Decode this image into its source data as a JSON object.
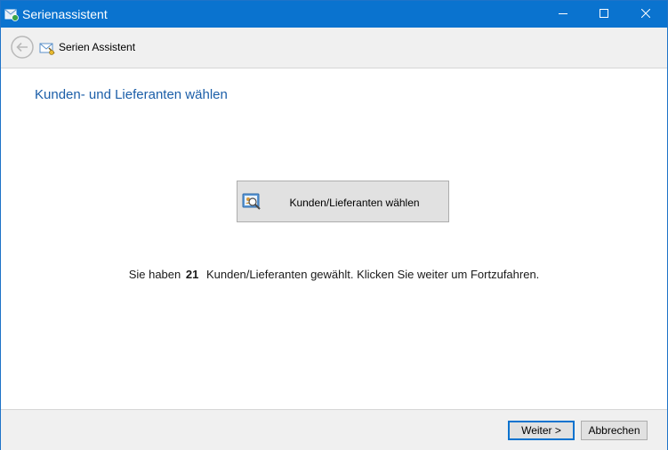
{
  "window": {
    "title": "Serienassistent",
    "accent_color": "#0a73cf"
  },
  "titlebar": {
    "icon": "mail-merge-icon",
    "controls": [
      "minimize-icon",
      "maximize-icon",
      "close-icon"
    ]
  },
  "nav": {
    "back_icon": "back-arrow-icon",
    "icon": "mail-wizard-icon",
    "title": "Serien Assistent"
  },
  "main": {
    "heading": "Kunden- und Lieferanten wählen",
    "heading_color": "#1b5ea8",
    "select_button": {
      "icon": "search-contacts-icon",
      "label": "Kunden/Lieferanten wählen"
    },
    "status": {
      "prefix": "Sie haben",
      "count": "21",
      "suffix": "Kunden/Lieferanten gewählt. Klicken Sie weiter um Fortzufahren."
    }
  },
  "footer": {
    "next_label": "Weiter >",
    "cancel_label": "Abbrechen"
  }
}
